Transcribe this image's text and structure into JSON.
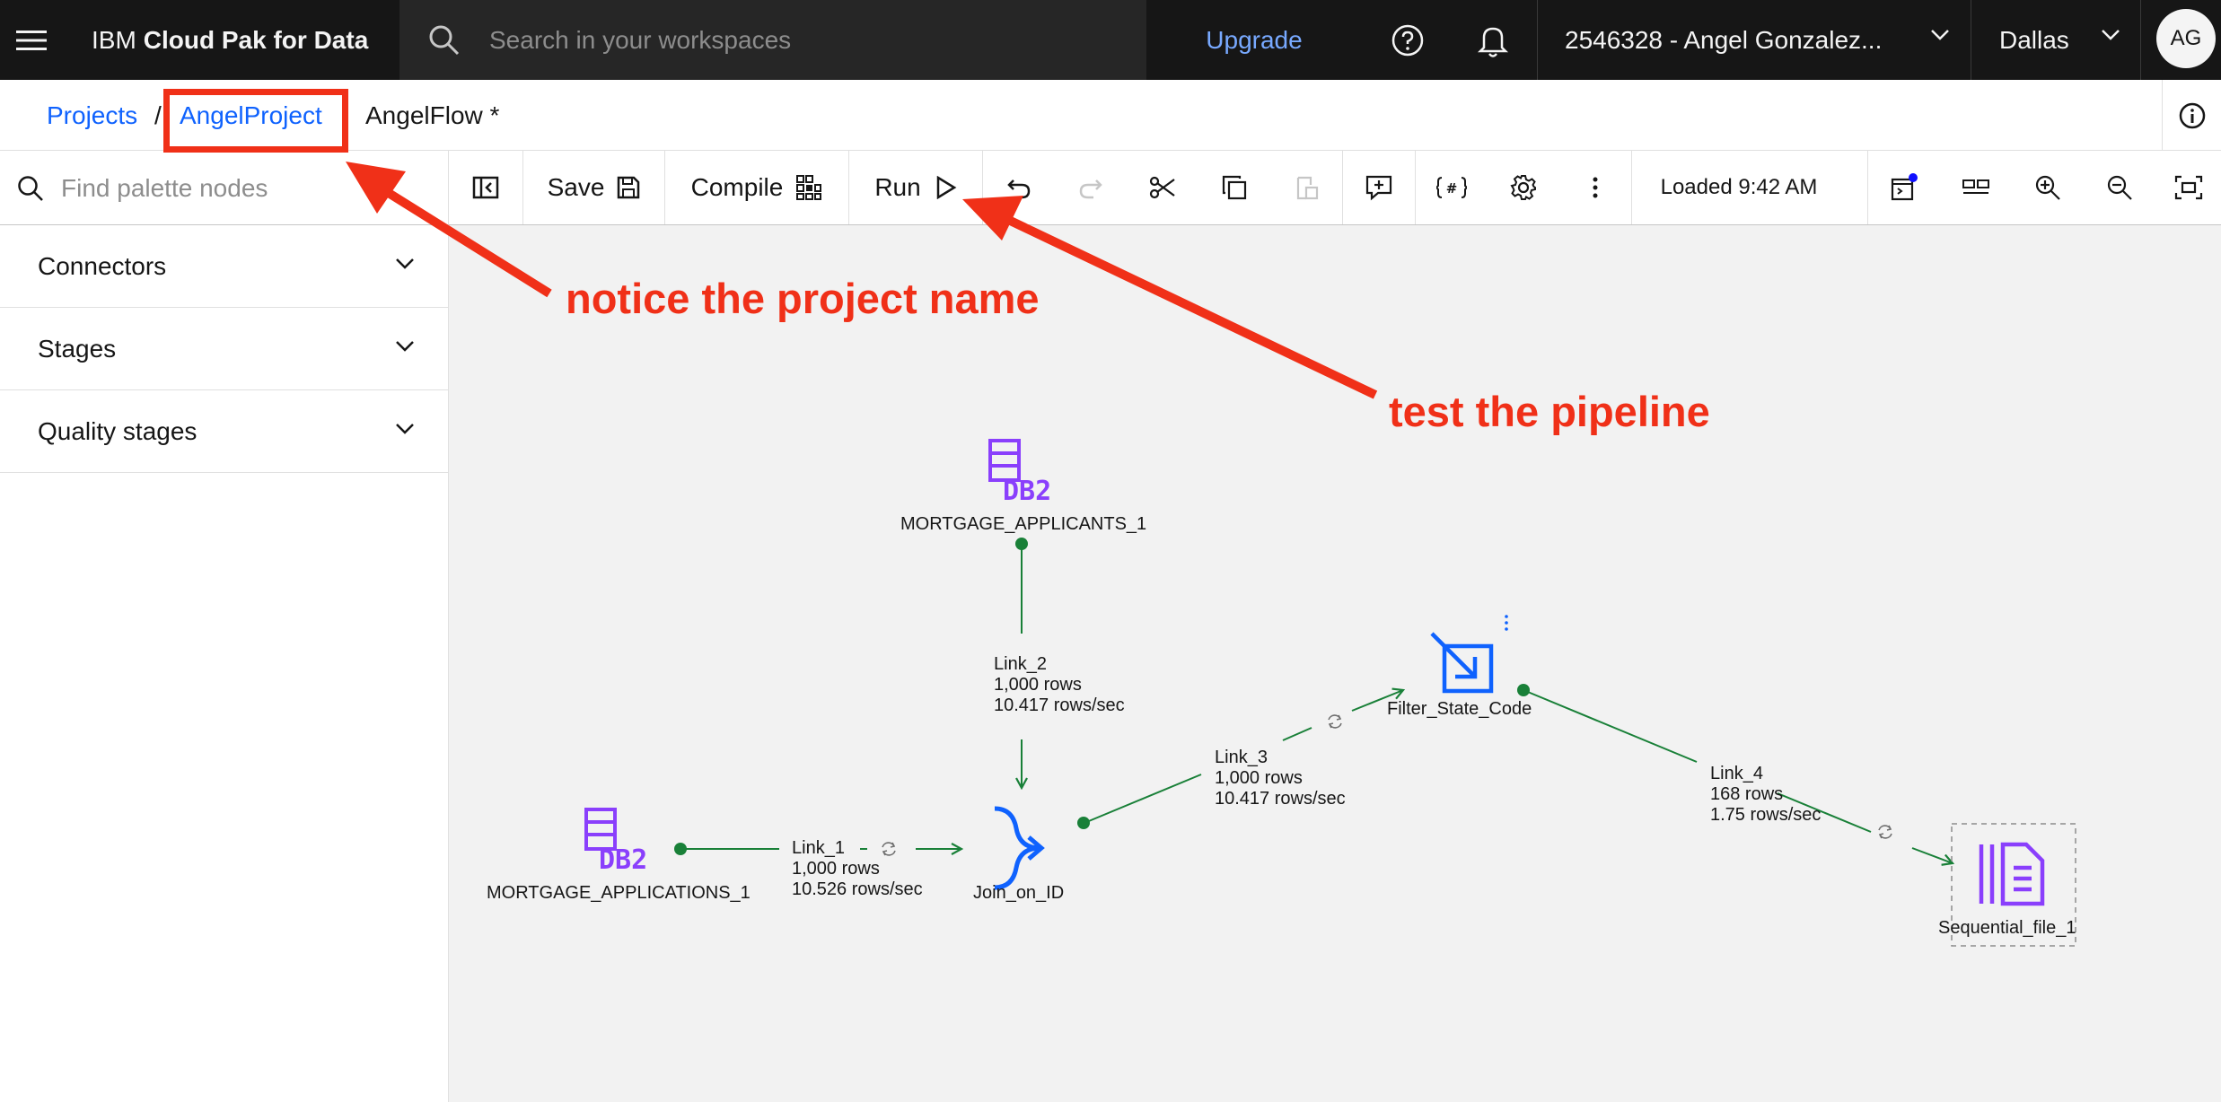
{
  "header": {
    "brand_prefix": "IBM",
    "brand_name": "Cloud Pak for Data",
    "search_placeholder": "Search in your workspaces",
    "upgrade_label": "Upgrade",
    "account_label": "2546328 - Angel Gonzalez...",
    "region_label": "Dallas",
    "avatar_initials": "AG"
  },
  "breadcrumb": {
    "projects": "Projects",
    "separator": "/",
    "project": "AngelProject",
    "flow": "AngelFlow *"
  },
  "toolbar": {
    "palette_search_placeholder": "Find palette nodes",
    "save_label": "Save",
    "compile_label": "Compile",
    "run_label": "Run",
    "loaded_label": "Loaded 9:42 AM",
    "icons": [
      "collapse-palette-icon",
      "save-icon",
      "compile-icon",
      "run-icon",
      "undo-icon",
      "redo-icon",
      "cut-icon",
      "copy-icon",
      "paste-icon",
      "add-comment-icon",
      "parameters-icon",
      "settings-icon",
      "overflow-menu-icon",
      "run-log-icon",
      "arrange-icon",
      "zoom-in-icon",
      "zoom-out-icon",
      "fit-to-screen-icon"
    ]
  },
  "palette": {
    "sections": [
      {
        "label": "Connectors"
      },
      {
        "label": "Stages"
      },
      {
        "label": "Quality stages"
      }
    ]
  },
  "canvas": {
    "nodes": {
      "applicants": "MORTGAGE_APPLICANTS_1",
      "applications": "MORTGAGE_APPLICATIONS_1",
      "join": "Join_on_ID",
      "filter": "Filter_State_Code",
      "sequential": "Sequential_file_1"
    },
    "links": {
      "link_1": {
        "name": "Link_1",
        "rows": "1,000 rows",
        "rate": "10.526 rows/sec"
      },
      "link_2": {
        "name": "Link_2",
        "rows": "1,000 rows",
        "rate": "10.417 rows/sec"
      },
      "link_3": {
        "name": "Link_3",
        "rows": "1,000 rows",
        "rate": "10.417 rows/sec"
      },
      "link_4": {
        "name": "Link_4",
        "rows": "168 rows",
        "rate": "1.75 rows/sec"
      }
    }
  },
  "annotations": {
    "project_note": "notice the project name",
    "run_note": "test the pipeline"
  },
  "colors": {
    "link_green": "#198038",
    "db2_purple": "#8a3ffc",
    "stage_blue": "#0f62fe",
    "annotation_red": "#f03018"
  }
}
